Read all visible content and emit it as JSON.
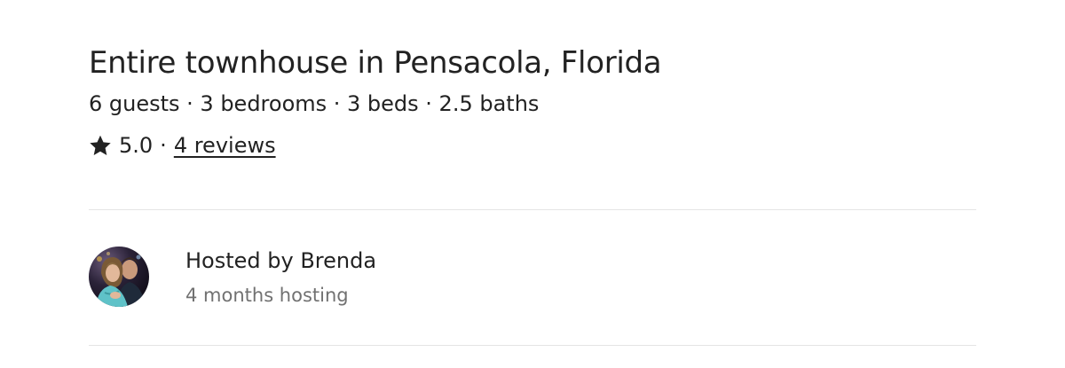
{
  "listing": {
    "title": "Entire townhouse in Pensacola, Florida",
    "overview": "6 guests · 3 bedrooms · 3 beds · 2.5 baths",
    "rating": {
      "icon": "star-icon",
      "value": "5.0",
      "separator": "·",
      "reviews_label": "4 reviews"
    }
  },
  "host": {
    "hosted_by": "Hosted by Brenda",
    "duration": "4 months hosting",
    "avatar_icon": "host-avatar-photo"
  },
  "colors": {
    "text_primary": "#222222",
    "text_secondary": "#717171",
    "divider": "#e4e4e4"
  }
}
